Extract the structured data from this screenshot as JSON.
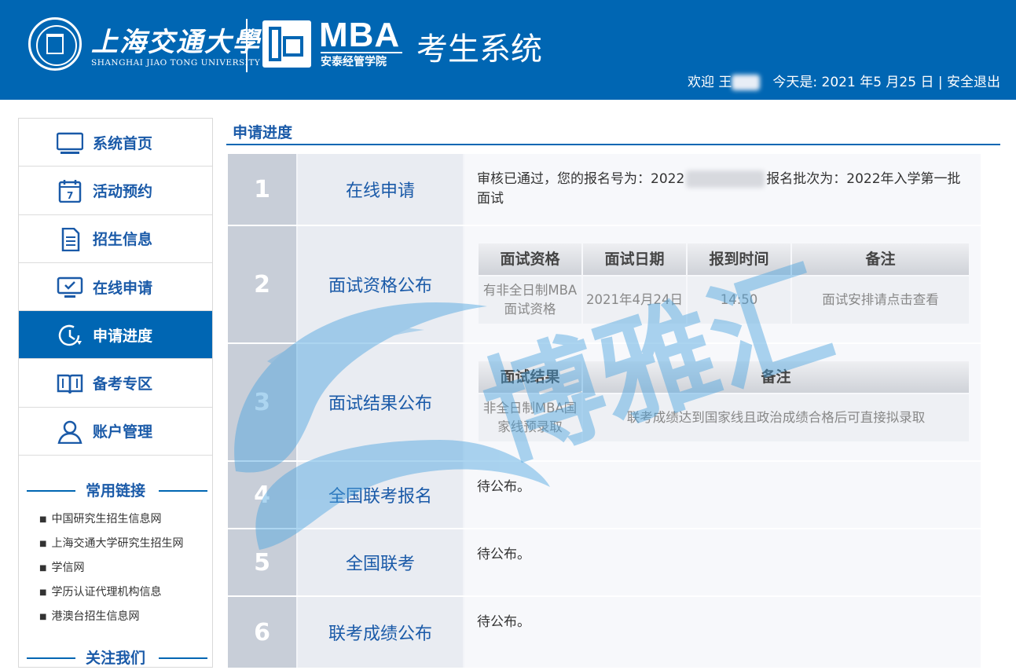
{
  "header": {
    "university_cn": "上海交通大學",
    "university_en": "SHANGHAI JIAO TONG UNIVERSITY",
    "mba": "MBA",
    "school": "安泰经管学院",
    "system_title": "考生系统",
    "welcome": "欢迎 王",
    "today_label": "今天是: 2021 年5 月25 日 |",
    "logout": "安全退出"
  },
  "sidebar": {
    "items": [
      {
        "label": "系统首页",
        "icon": "monitor-icon"
      },
      {
        "label": "活动预约",
        "icon": "calendar-icon"
      },
      {
        "label": "招生信息",
        "icon": "document-icon"
      },
      {
        "label": "在线申请",
        "icon": "screen-check-icon"
      },
      {
        "label": "申请进度",
        "icon": "clock-progress-icon"
      },
      {
        "label": "备考专区",
        "icon": "book-icon"
      },
      {
        "label": "账户管理",
        "icon": "user-icon"
      }
    ],
    "links_heading": "常用链接",
    "links": [
      "中国研究生招生信息网",
      "上海交通大学研究生招生网",
      "学信网",
      "学历认证代理机构信息",
      "港澳台招生信息网"
    ],
    "follow_heading": "关注我们"
  },
  "main": {
    "section_title": "申请进度",
    "steps": [
      {
        "num": "1",
        "name": "在线申请",
        "text_a": "审核已通过，您的报名号为：2022",
        "text_b": "报名批次为：2022年入学第一批面试"
      },
      {
        "num": "2",
        "name": "面试资格公布",
        "table": {
          "headers": [
            "面试资格",
            "面试日期",
            "报到时间",
            "备注"
          ],
          "row": [
            "有非全日制MBA面试资格",
            "2021年4月24日",
            "14:50",
            "面试安排请点击查看"
          ]
        }
      },
      {
        "num": "3",
        "name": "面试结果公布",
        "table": {
          "headers": [
            "面试结果",
            "备注"
          ],
          "row": [
            "非全日制MBA国家线预录取",
            "联考成绩达到国家线且政治成绩合格后可直接拟录取"
          ]
        }
      },
      {
        "num": "4",
        "name": "全国联考报名",
        "text": "待公布。"
      },
      {
        "num": "5",
        "name": "全国联考",
        "text": "待公布。"
      },
      {
        "num": "6",
        "name": "联考成绩公布",
        "text": "待公布。"
      }
    ]
  },
  "watermark": "博雅汇",
  "colors": {
    "header_bg": "#0066b3",
    "accent_text": "#1a5aa8",
    "step_num_bg": "#c8ced8",
    "watermark": "#4aa3df"
  }
}
